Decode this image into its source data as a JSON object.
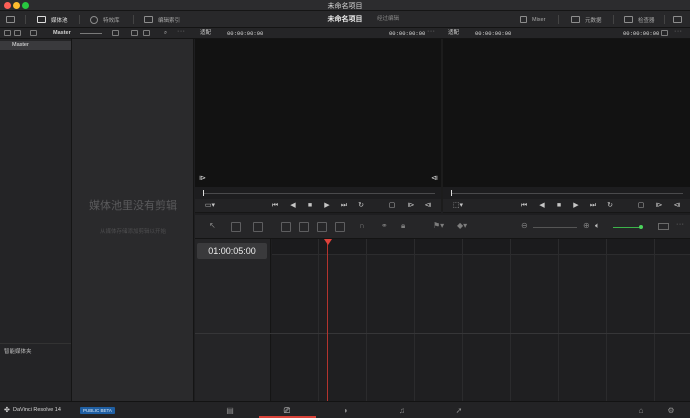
{
  "window": {
    "title": "未命名项目"
  },
  "toolbar": {
    "media_pool": "媒体池",
    "effects_library": "特效库",
    "edit_index": "编辑索引",
    "project_title": "未命名项目",
    "edit_mode": "经过编辑",
    "mixer": "Mixer",
    "metadata": "元数据",
    "inspector": "检查器"
  },
  "bins_header": {
    "label": "Master"
  },
  "bins": {
    "items": [
      {
        "label": "Master"
      }
    ],
    "smart_bins": "智能媒体夹"
  },
  "media_pool": {
    "empty_title": "媒体池里没有剪辑",
    "empty_hint": "从媒体存储添加剪辑以开始"
  },
  "source_viewer": {
    "fit": "适配",
    "timecode_left": "00:00:00:00",
    "timecode_right": "00:00:00:00"
  },
  "timeline_viewer": {
    "fit": "适配",
    "timecode_left": "00:00:00:00",
    "timecode_right": "00:00:00:00"
  },
  "timeline": {
    "timecode": "01:00:05:00"
  },
  "statusbar": {
    "app_name": "DaVinci Resolve 14",
    "badge": "PUBLIC BETA",
    "pages": [
      {
        "name": "media",
        "icon": "▤"
      },
      {
        "name": "edit",
        "icon": "⎚"
      },
      {
        "name": "color",
        "icon": "◑"
      },
      {
        "name": "fairlight",
        "icon": "♫"
      },
      {
        "name": "deliver",
        "icon": "➚"
      }
    ],
    "home_icon": "⌂",
    "settings_icon": "⚙"
  },
  "colors": {
    "accent": "#d9433a",
    "playhead": "#e0423b",
    "badge": "#1f5fa3"
  }
}
